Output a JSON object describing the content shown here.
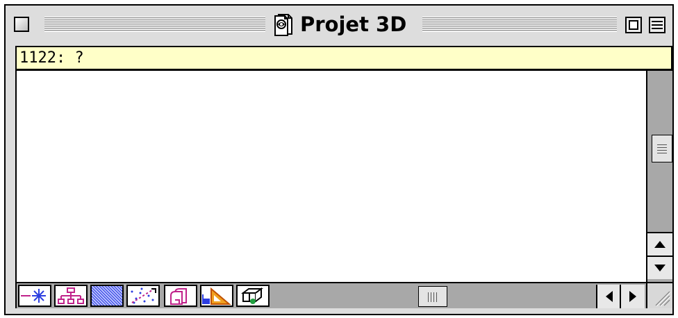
{
  "window": {
    "title": "Projet 3D"
  },
  "status_field": {
    "text": "1122: ?"
  },
  "toolbar": {
    "tools": [
      {
        "name": "snowflake-line-icon"
      },
      {
        "name": "hierarchy-tree-icon"
      },
      {
        "name": "blue-pattern-fill-icon"
      },
      {
        "name": "scatter-points-icon"
      },
      {
        "name": "stacked-layers-icon"
      },
      {
        "name": "set-square-ruler-icon"
      },
      {
        "name": "3d-box-view-icon"
      }
    ]
  },
  "colors": {
    "window_bg": "#dddddd",
    "status_bg": "#ffffc8",
    "content_bg": "#ffffff",
    "scrollbar_track": "#a8a8a8",
    "accent_magenta": "#c0228a",
    "accent_blue": "#2d3ee0"
  }
}
